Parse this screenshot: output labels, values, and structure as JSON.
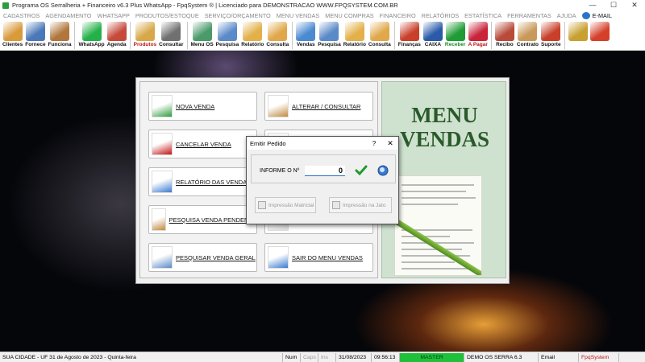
{
  "window": {
    "title": "Programa OS Serralheria + Financeiro v6.3 Plus WhatsApp - FpqSystem ® | Licenciado para  DEMONSTRACAO WWW.FPQSYSTEM.COM.BR",
    "minimize": "—",
    "maximize": "☐",
    "close": "✕"
  },
  "menu": [
    "CADASTROS",
    "AGENDAMENTO",
    "WHATSAPP",
    "PRODUTOS/ESTOQUE",
    "SERVIÇO/ORÇAMENTO",
    "MENU VENDAS",
    "MENU COMPRAS",
    "FINANCEIRO",
    "RELATÓRIOS",
    "ESTATÍSTICA",
    "FERRAMENTAS",
    "AJUDA",
    "E-MAIL"
  ],
  "toolbar": [
    {
      "label": "Clientes",
      "icon": "clients-icon",
      "color": "#d99a3a",
      "style": ""
    },
    {
      "label": "Fornece",
      "icon": "suppliers-icon",
      "color": "#4a78b8",
      "style": ""
    },
    {
      "label": "Funciona",
      "icon": "employees-icon",
      "color": "#b0763c",
      "style": ""
    },
    {
      "label": "WhatsApp",
      "icon": "whatsapp-icon",
      "color": "#25b14a",
      "style": ""
    },
    {
      "label": "Agenda",
      "icon": "calendar-icon",
      "color": "#c64a3a",
      "style": ""
    },
    {
      "label": "Produtos",
      "icon": "products-icon",
      "color": "#d7a84a",
      "style": "red"
    },
    {
      "label": "Consultar",
      "icon": "barcode-icon",
      "color": "#707070",
      "style": ""
    },
    {
      "label": "Menu OS",
      "icon": "service-order-icon",
      "color": "#4a9a6a",
      "style": ""
    },
    {
      "label": "Pesquisa",
      "icon": "search-doc-icon",
      "color": "#5a8ac8",
      "style": ""
    },
    {
      "label": "Relatório",
      "icon": "report-icon",
      "color": "#e3b04a",
      "style": ""
    },
    {
      "label": "Consulta",
      "icon": "folder-icon",
      "color": "#e0a84a",
      "style": ""
    },
    {
      "label": "Vendas",
      "icon": "sales-monitor-icon",
      "color": "#4a8ad0",
      "style": ""
    },
    {
      "label": "Pesquisa",
      "icon": "search-doc-icon",
      "color": "#5a8ac8",
      "style": ""
    },
    {
      "label": "Relatório",
      "icon": "report-icon",
      "color": "#e3b04a",
      "style": ""
    },
    {
      "label": "Consulta",
      "icon": "folder-icon",
      "color": "#e0a84a",
      "style": ""
    },
    {
      "label": "Finanças",
      "icon": "finance-icon",
      "color": "#c9402a",
      "style": ""
    },
    {
      "label": "CAIXA",
      "icon": "cashbox-icon",
      "color": "#2a5aa8",
      "style": ""
    },
    {
      "label": "Receber",
      "icon": "receive-money-icon",
      "color": "#1f9c34",
      "style": "green"
    },
    {
      "label": "A Pagar",
      "icon": "pay-money-icon",
      "color": "#c8243a",
      "style": "red"
    },
    {
      "label": "Recibo",
      "icon": "receipt-icon",
      "color": "#b84a3a",
      "style": ""
    },
    {
      "label": "Contrato",
      "icon": "contract-icon",
      "color": "#c89a5a",
      "style": ""
    },
    {
      "label": "Suporte",
      "icon": "support-icon",
      "color": "#c8402a",
      "style": ""
    },
    {
      "label": "",
      "icon": "coins-icon",
      "color": "#c8a030",
      "style": ""
    },
    {
      "label": "",
      "icon": "exit-icon",
      "color": "#d4402a",
      "style": ""
    }
  ],
  "vendas_menu": {
    "buttons": [
      {
        "label": "NOVA VENDA",
        "icon": "new-sale-icon"
      },
      {
        "label": "ALTERAR / CONSULTAR",
        "icon": "edit-pen-icon"
      },
      {
        "label": "CANCELAR VENDA",
        "icon": "cancel-sale-icon"
      },
      {
        "label": "",
        "icon": "blank-icon"
      },
      {
        "label": "RELATÓRIO DAS VENDAS",
        "icon": "printer-icon"
      },
      {
        "label": "",
        "icon": "blank-icon"
      },
      {
        "label": "PESQUISA VENDA PENDENTE",
        "icon": "search-pending-icon"
      },
      {
        "label": "",
        "icon": "blank-icon"
      },
      {
        "label": "PESQUISAR VENDA GERAL",
        "icon": "search-general-icon"
      },
      {
        "label": "SAIR DO MENU VENDAS",
        "icon": "exit-menu-icon"
      }
    ],
    "banner_line1": "MENU",
    "banner_line2": "VENDAS"
  },
  "dialog": {
    "title": "Emitir Pedido",
    "help": "?",
    "close": "✕",
    "field_label": "INFORME O Nº",
    "field_value": "0",
    "print_matrix": "Impressão Matricial",
    "print_inkjet": "Impressão na Jato"
  },
  "status": {
    "city": "SUA CIDADE - UF 31 de Agosto de 2023 - Quinta-feira",
    "num": "Num",
    "caps": "Caps",
    "ins": "Ins",
    "date": "31/08/2023",
    "time": "09:56:13",
    "user": "MASTER",
    "company": "DEMO OS SERRA 6.3",
    "email": "Email",
    "brand": "FpqSystem"
  }
}
